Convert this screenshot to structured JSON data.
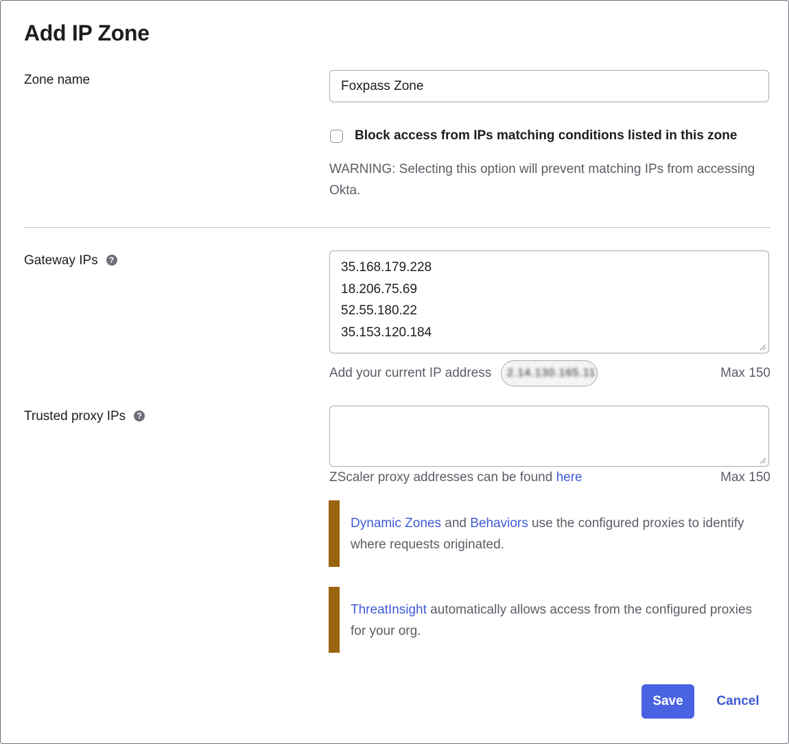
{
  "dialog": {
    "title": "Add IP Zone"
  },
  "zone_name": {
    "label": "Zone name",
    "value": "Foxpass Zone"
  },
  "block_access": {
    "checked": false,
    "label": "Block access from IPs matching conditions listed in this zone",
    "warning": "WARNING: Selecting this option will prevent matching IPs from accessing Okta."
  },
  "gateway_ips": {
    "label": "Gateway IPs",
    "help_icon": "question-circle-icon",
    "values": [
      "35.168.179.228",
      "18.206.75.69",
      "52.55.180.22",
      "35.153.120.184"
    ],
    "add_current_ip_label": "Add your current IP address",
    "current_ip_redacted": "2.14.130.165.11",
    "max_label": "Max 150"
  },
  "trusted_proxy_ips": {
    "label": "Trusted proxy IPs",
    "help_icon": "question-circle-icon",
    "value": "",
    "zscaler_text": "ZScaler proxy addresses can be found",
    "zscaler_link": "here",
    "max_label": "Max 150"
  },
  "callouts": [
    {
      "link1": "Dynamic Zones",
      "and": " and ",
      "link2": "Behaviors",
      "text": " use the configured proxies to identify where requests originated."
    },
    {
      "link1": "ThreatInsight",
      "text": " automatically allows access from the configured proxies for your org."
    }
  ],
  "actions": {
    "save_label": "Save",
    "cancel_label": "Cancel"
  },
  "colors": {
    "primary": "#4862e1",
    "link": "#3e5ad6",
    "callout_bar": "#9b6411"
  }
}
